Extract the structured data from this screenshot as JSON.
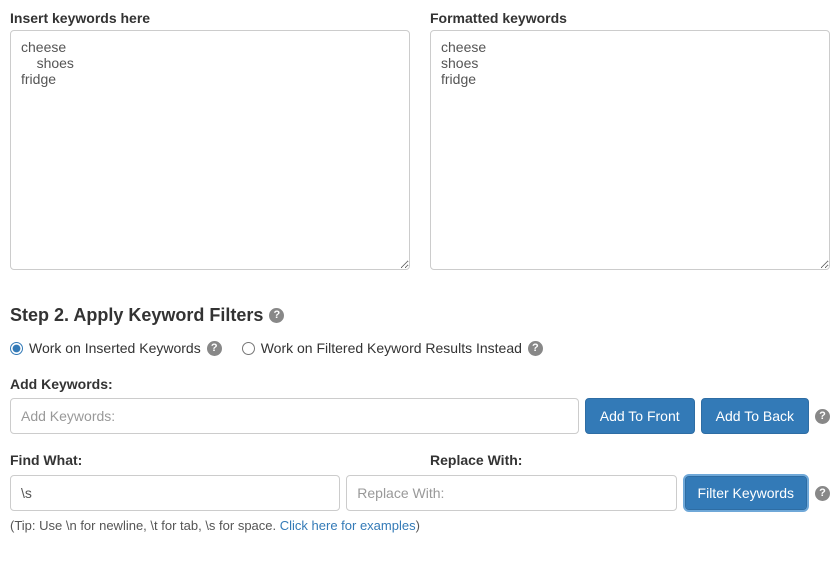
{
  "top": {
    "insert_label": "Insert keywords here",
    "insert_value": "cheese\n    shoes\nfridge",
    "formatted_label": "Formatted keywords",
    "formatted_value": "cheese\nshoes\nfridge"
  },
  "step2": {
    "heading": "Step 2. Apply Keyword Filters",
    "radio_inserted": "Work on Inserted Keywords",
    "radio_filtered": "Work on Filtered Keyword Results Instead"
  },
  "addkw": {
    "label": "Add Keywords:",
    "placeholder": "Add Keywords:",
    "btn_front": "Add To Front",
    "btn_back": "Add To Back"
  },
  "findreplace": {
    "find_label": "Find What:",
    "find_value": "\\s",
    "replace_label": "Replace With:",
    "replace_placeholder": "Replace With:",
    "btn_filter": "Filter Keywords"
  },
  "tip": {
    "text_pre": "(Tip: Use \\n for newline, \\t for tab, \\s for space.  ",
    "link": "Click here for examples",
    "text_post": ")"
  },
  "icons": {
    "help_glyph": "?"
  }
}
